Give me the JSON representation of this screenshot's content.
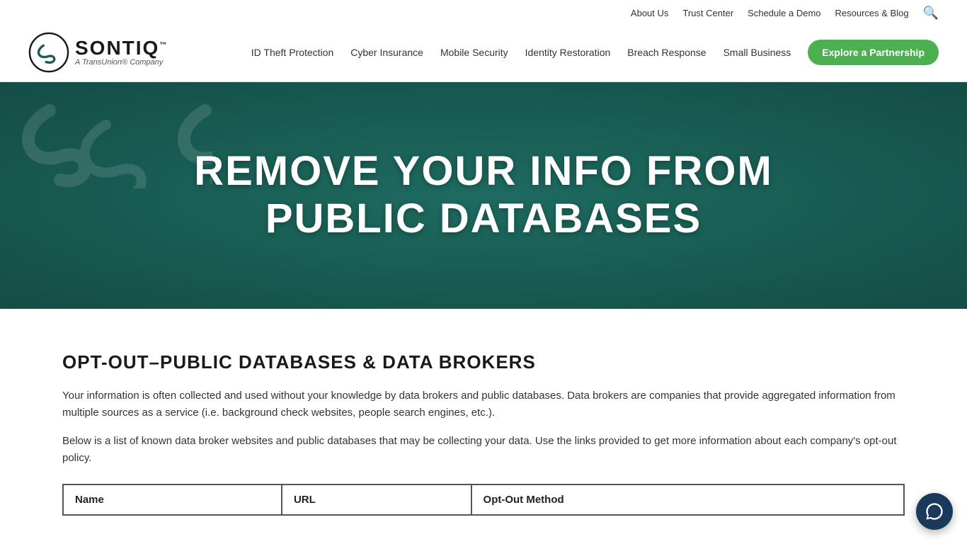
{
  "topbar": {
    "links": [
      {
        "label": "About Us",
        "name": "about-us-link"
      },
      {
        "label": "Trust Center",
        "name": "trust-center-link"
      },
      {
        "label": "Schedule a Demo",
        "name": "schedule-demo-link"
      },
      {
        "label": "Resources & Blog",
        "name": "resources-blog-link"
      }
    ]
  },
  "logo": {
    "name": "SONTIQ",
    "tm": "™",
    "subtitle": "A TransUnion® Company"
  },
  "nav": {
    "links": [
      {
        "label": "ID Theft Protection",
        "name": "nav-id-theft"
      },
      {
        "label": "Cyber Insurance",
        "name": "nav-cyber-insurance"
      },
      {
        "label": "Mobile Security",
        "name": "nav-mobile-security"
      },
      {
        "label": "Identity Restoration",
        "name": "nav-identity-restoration"
      },
      {
        "label": "Breach Response",
        "name": "nav-breach-response"
      },
      {
        "label": "Small Business",
        "name": "nav-small-business"
      }
    ],
    "cta": {
      "label": "Explore a Partnership",
      "name": "explore-partnership-btn"
    }
  },
  "hero": {
    "title": "REMOVE YOUR INFO FROM PUBLIC DATABASES"
  },
  "content": {
    "section_title": "OPT-OUT–PUBLIC DATABASES & DATA BROKERS",
    "paragraph1": "Your information is often collected and used without your knowledge by data brokers and public databases. Data brokers are companies that provide aggregated information from multiple sources as a service (i.e. background check websites, people search engines, etc.).",
    "paragraph2": "Below is a list of known data broker websites and public databases that may be collecting your data. Use the links provided to get more information about each company's opt-out policy.",
    "table": {
      "headers": [
        "Name",
        "URL",
        "Opt-Out Method"
      ],
      "rows": []
    }
  }
}
